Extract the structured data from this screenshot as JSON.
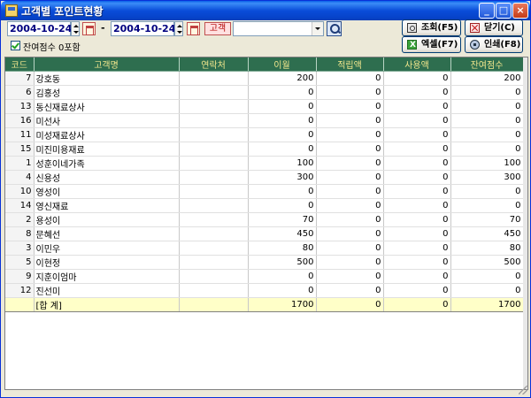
{
  "window": {
    "title": "고객별 포인트현황"
  },
  "filters": {
    "date_from": "2004-10-24",
    "date_to": "2004-10-24",
    "separator": "-",
    "customer_label": "고객",
    "customer_value": "",
    "include_zero_balance_label": "잔여점수 0포함",
    "include_zero_balance_checked": true
  },
  "actions": {
    "inquiry": "조회(F5)",
    "close": "닫기(C)",
    "excel": "엑셀(F7)",
    "print": "인쇄(F8)"
  },
  "table": {
    "columns": [
      "코드",
      "고객명",
      "연락처",
      "이월",
      "적립액",
      "사용액",
      "잔여점수"
    ],
    "rows": [
      {
        "code": "7",
        "name": "강호동",
        "contact": "",
        "carryover": "200",
        "earned": "0",
        "used": "0",
        "balance": "200"
      },
      {
        "code": "6",
        "name": "김홍성",
        "contact": "",
        "carryover": "0",
        "earned": "0",
        "used": "0",
        "balance": "0"
      },
      {
        "code": "13",
        "name": "동신재료상사",
        "contact": "",
        "carryover": "0",
        "earned": "0",
        "used": "0",
        "balance": "0"
      },
      {
        "code": "16",
        "name": "미선사",
        "contact": "",
        "carryover": "0",
        "earned": "0",
        "used": "0",
        "balance": "0"
      },
      {
        "code": "11",
        "name": "미성재료상사",
        "contact": "",
        "carryover": "0",
        "earned": "0",
        "used": "0",
        "balance": "0"
      },
      {
        "code": "15",
        "name": "미진미용재료",
        "contact": "",
        "carryover": "0",
        "earned": "0",
        "used": "0",
        "balance": "0"
      },
      {
        "code": "1",
        "name": "성훈이네가족",
        "contact": "",
        "carryover": "100",
        "earned": "0",
        "used": "0",
        "balance": "100"
      },
      {
        "code": "4",
        "name": "신용성",
        "contact": "",
        "carryover": "300",
        "earned": "0",
        "used": "0",
        "balance": "300"
      },
      {
        "code": "10",
        "name": "영성이",
        "contact": "",
        "carryover": "0",
        "earned": "0",
        "used": "0",
        "balance": "0"
      },
      {
        "code": "14",
        "name": "영신재료",
        "contact": "",
        "carryover": "0",
        "earned": "0",
        "used": "0",
        "balance": "0"
      },
      {
        "code": "2",
        "name": "용성이",
        "contact": "",
        "carryover": "70",
        "earned": "0",
        "used": "0",
        "balance": "70"
      },
      {
        "code": "8",
        "name": "문혜선",
        "contact": "",
        "carryover": "450",
        "earned": "0",
        "used": "0",
        "balance": "450"
      },
      {
        "code": "3",
        "name": "이민우",
        "contact": "",
        "carryover": "80",
        "earned": "0",
        "used": "0",
        "balance": "80"
      },
      {
        "code": "5",
        "name": "이현정",
        "contact": "",
        "carryover": "500",
        "earned": "0",
        "used": "0",
        "balance": "500"
      },
      {
        "code": "9",
        "name": "지훈이엄마",
        "contact": "",
        "carryover": "0",
        "earned": "0",
        "used": "0",
        "balance": "0"
      },
      {
        "code": "12",
        "name": "진선미",
        "contact": "",
        "carryover": "0",
        "earned": "0",
        "used": "0",
        "balance": "0"
      }
    ],
    "total": {
      "label": "[합 계]",
      "carryover": "1700",
      "earned": "0",
      "used": "0",
      "balance": "1700"
    }
  },
  "colors": {
    "header_bg": "#2E6E4F",
    "header_text": "#F0E68C",
    "total_bg": "#FFFFC8",
    "titlebar": "#0A4DD9"
  }
}
